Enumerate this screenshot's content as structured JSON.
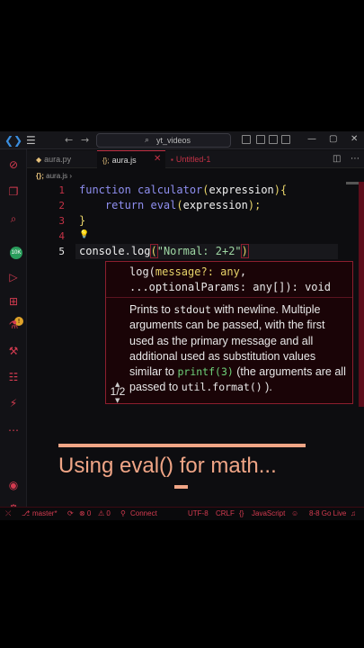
{
  "colors": {
    "accent": "#c43246",
    "caption": "#f0a586",
    "hover_bg": "#1a0407"
  },
  "titlebar": {
    "menu_icon": "hamburger-icon",
    "search": "yt_videos",
    "window_controls": [
      "—",
      "▢",
      "✕"
    ]
  },
  "tabs": [
    {
      "label": "aura.py",
      "icon": "python-icon",
      "active": false
    },
    {
      "label": "aura.js",
      "icon": "{};",
      "active": true
    },
    {
      "label": "Untitled-1",
      "icon": "dot-icon",
      "active": false
    }
  ],
  "breadcrumb": {
    "lang": "{};",
    "file": "aura.js",
    "sep": "›"
  },
  "editor": {
    "line_numbers": [
      "1",
      "2",
      "3",
      "4",
      "5"
    ],
    "lines": {
      "l1_kw": "function ",
      "l1_fn": "calculator",
      "l1_p1": "(",
      "l1_arg": "expression",
      "l1_p2": "){",
      "l2_indent": "    ",
      "l2_kw": "return ",
      "l2_fn": "eval",
      "l2_p1": "(",
      "l2_arg": "expression",
      "l2_p2": ");",
      "l3": "}",
      "l5_obj": "console",
      "l5_dot": ".",
      "l5_fn": "log",
      "l5_p1": "(",
      "l5_str": "\"Normal: 2+2\"",
      "l5_p2": ")"
    }
  },
  "hover": {
    "sig_fn": "log(",
    "sig_param": "message?: any",
    "sig_rest1": ",",
    "sig_line2": "...optionalParams: any[]): void",
    "doc_1": "Prints to ",
    "doc_code1": "stdout",
    "doc_2": " with newline. Multiple arguments can be passed, with the first used as the primary message and all additional used as substitution values similar to ",
    "doc_code2": "printf(3)",
    "doc_3": " (the arguments are all passed to ",
    "doc_code3": "util.format()",
    "doc_4": " ).",
    "pager": "1/2"
  },
  "caption": "Using eval() for math...",
  "status": {
    "branch": "master*",
    "errors": "⊗ 0",
    "warnings": "⚠ 0",
    "connect": "Connect",
    "encoding": "UTF-8",
    "eol": "CRLF",
    "language": "JavaScript",
    "golive": "8-8 Go Live"
  }
}
